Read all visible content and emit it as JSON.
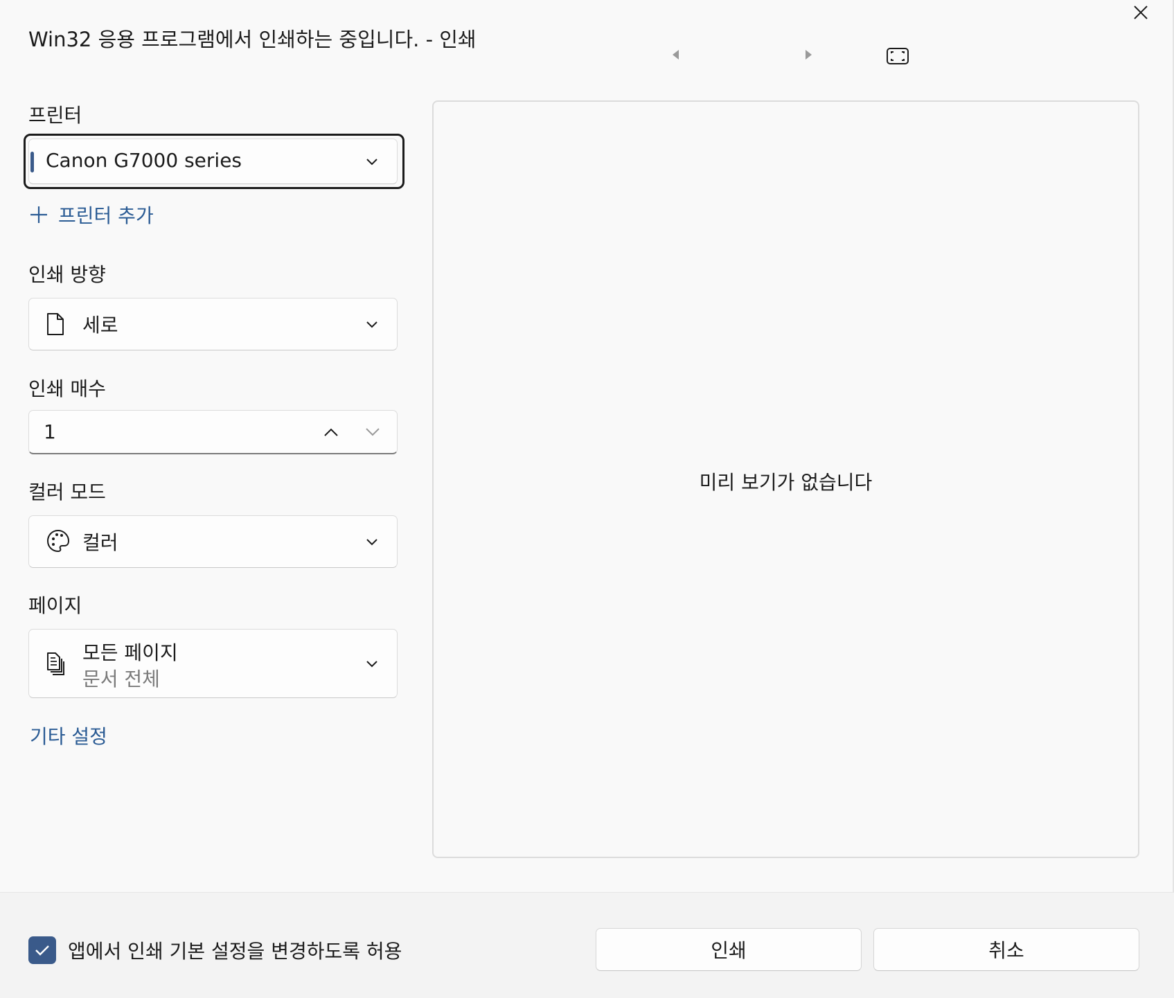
{
  "window": {
    "title": "Win32 응용 프로그램에서 인쇄하는 중입니다. - 인쇄"
  },
  "printer": {
    "label": "프린터",
    "selected": "Canon G7000 series",
    "add_label": "프린터 추가"
  },
  "orientation": {
    "label": "인쇄 방향",
    "selected": "세로"
  },
  "copies": {
    "label": "인쇄 매수",
    "value": "1"
  },
  "color_mode": {
    "label": "컬러 모드",
    "selected": "컬러"
  },
  "pages": {
    "label": "페이지",
    "selected": "모든 페이지",
    "description": "문서 전체"
  },
  "more_settings": {
    "label": "기타 설정"
  },
  "preview": {
    "message": "미리 보기가 없습니다"
  },
  "footer": {
    "allow_app_label": "앱에서 인쇄 기본 설정을 변경하도록 허용",
    "allow_app_checked": true,
    "print_button": "인쇄",
    "cancel_button": "취소"
  },
  "colors": {
    "accent": "#3a5a8a",
    "link": "#2a5b94"
  }
}
